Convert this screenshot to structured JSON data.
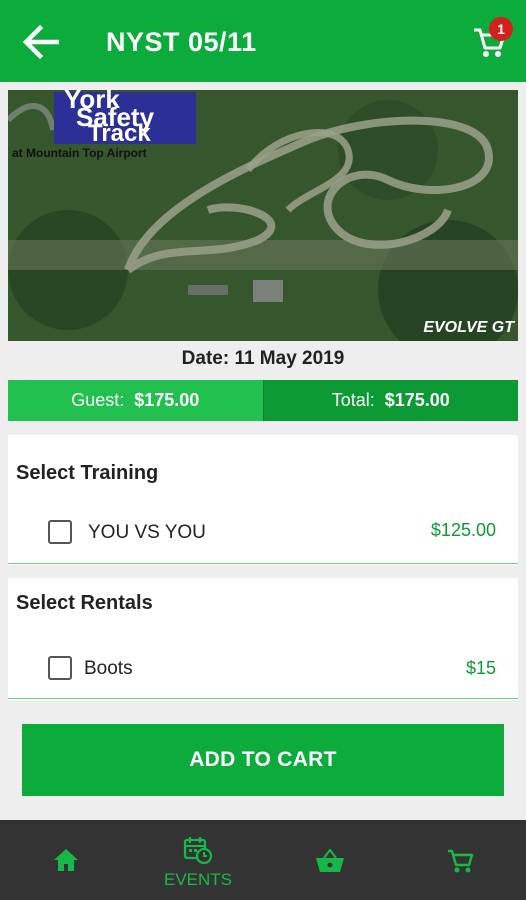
{
  "appbar": {
    "title": "NYST 05/11",
    "cart_badge": "1",
    "back_icon": "arrow-left-icon",
    "cart_icon": "cart-icon"
  },
  "hero": {
    "logo_line1": "York",
    "logo_line2": "Safety",
    "logo_line3": "Track",
    "logo_sub": "at Mountain Top Airport",
    "corner_brand": "EVOLVE GT"
  },
  "event": {
    "date_label": "Date: 11 May 2019"
  },
  "pricing": {
    "guest_label": "Guest:",
    "guest_amount": "$175.00",
    "total_label": "Total:",
    "total_amount": "$175.00"
  },
  "training": {
    "title": "Select Training",
    "items": [
      {
        "label": "YOU VS YOU",
        "price": "$125.00",
        "checked": false
      }
    ]
  },
  "rentals": {
    "title": "Select Rentals",
    "items": [
      {
        "label": "Boots",
        "price": "$15",
        "checked": false
      }
    ]
  },
  "actions": {
    "add_to_cart": "ADD TO CART"
  },
  "bottom_nav": {
    "items": [
      {
        "icon": "home-icon",
        "label": ""
      },
      {
        "icon": "calendar-clock-icon",
        "label": "EVENTS"
      },
      {
        "icon": "basket-icon",
        "label": ""
      },
      {
        "icon": "cart-icon",
        "label": ""
      }
    ]
  },
  "colors": {
    "primary": "#0bab3c",
    "price_left": "#22c14f",
    "price_right": "#0c9a35",
    "badge": "#d41f1f",
    "nav_bg": "#333333"
  }
}
